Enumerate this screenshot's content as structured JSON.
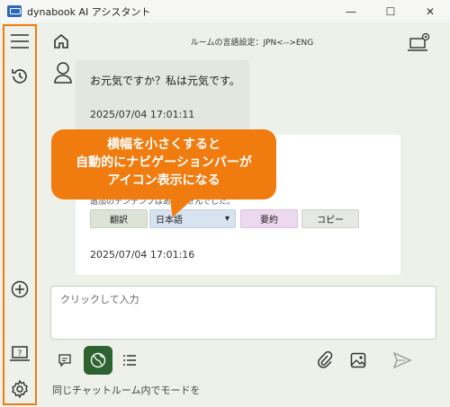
{
  "window": {
    "title": "dynabook AI アシスタント",
    "controls": {
      "minimize": "—",
      "maximize": "☐",
      "close": "✕"
    }
  },
  "sidebar": {
    "icons": [
      "menu-icon",
      "history-icon",
      "add-icon",
      "help-icon",
      "gear-icon"
    ],
    "accent": "#f07c10"
  },
  "header": {
    "room_language": "ルームの言語設定：JPN<-->ENG"
  },
  "chat": {
    "user_message": {
      "text": "お元気ですか？私は元気です。",
      "timestamp": "2025/07/04 17:01:11"
    },
    "ai_message": {
      "clipped_text": "追加のテン゙デ゙ンプはありませんでした。",
      "actions": {
        "translate": "翻訳",
        "language_selected": "日本語",
        "summary": "要約",
        "copy": "コピー"
      },
      "timestamp": "2025/07/04 17:01:16"
    }
  },
  "callout": {
    "line1": "横幅を小さくすると",
    "line2": "自動的にナビゲーションバーが",
    "line3": "アイコン表示になる",
    "color": "#f07c10"
  },
  "input": {
    "placeholder": "クリックして入力"
  },
  "toolbar": {
    "icons": [
      "chat-icon",
      "globe-icon",
      "list-icon",
      "paperclip-icon",
      "image-icon",
      "send-icon"
    ],
    "active_color": "#2e6230"
  },
  "footer": {
    "hint": "同じチャットルーム内でモードを"
  }
}
